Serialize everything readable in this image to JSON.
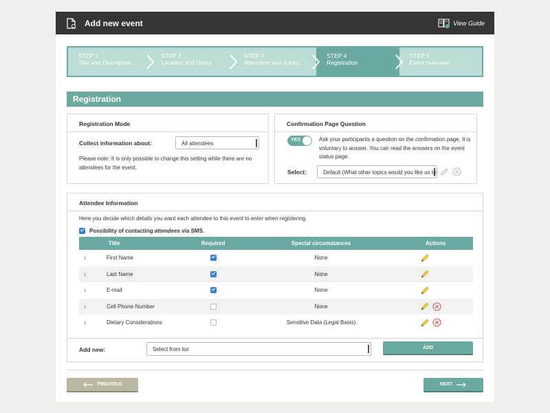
{
  "header": {
    "title": "Add new event",
    "guide_label": "View Guide"
  },
  "steps": [
    {
      "num": "STEP 1",
      "label": "Title and Description"
    },
    {
      "num": "STEP 2",
      "label": "Location and Dates"
    },
    {
      "num": "STEP 3",
      "label": "Attendees and tickets"
    },
    {
      "num": "STEP 4",
      "label": "Registration"
    },
    {
      "num": "STEP 5",
      "label": "Event overview"
    }
  ],
  "active_step": 4,
  "section_title": "Registration",
  "registration_mode": {
    "title": "Registration Mode",
    "collect_label": "Collect information about:",
    "collect_value": "All attendees",
    "note": "Please note: It is only possible to change this setting while there are no attendees for the event."
  },
  "confirmation": {
    "title": "Confirmation Page Question",
    "toggle_label": "YES",
    "toggle_on": true,
    "description": "Ask your participants a question on the confirmation page. It is voluntary to answer. You can read the answers on the event status page.",
    "select_label": "Select:",
    "select_value": "Default (What other topics would you like us to"
  },
  "attendee_info": {
    "title": "Attendee Information",
    "intro": "Here you decide which details you want each attendee to this event to enter when registering.",
    "sms_label": "Possibility of contacting attendees via SMS.",
    "sms_checked": true,
    "columns": {
      "title": "Title",
      "required": "Required",
      "special": "Special circumstances",
      "actions": "Actions"
    },
    "rows": [
      {
        "title": "First Name",
        "required": true,
        "special": "None",
        "deletable": false
      },
      {
        "title": "Last Name",
        "required": true,
        "special": "None",
        "deletable": false
      },
      {
        "title": "E-mail",
        "required": true,
        "special": "None",
        "deletable": false
      },
      {
        "title": "Cell Phone Number",
        "required": false,
        "special": "None",
        "deletable": true
      },
      {
        "title": "Dietary Considerations",
        "required": false,
        "special": "Sensitive Data (Legal Basis)",
        "deletable": true
      }
    ],
    "add_label": "Add new:",
    "add_select": "Select from list",
    "add_button": "ADD"
  },
  "nav": {
    "previous": "PREVIOUS",
    "next": "NEXT"
  },
  "colors": {
    "accent": "#6aaaa0",
    "accent_light": "#bcdcd8",
    "header": "#353535",
    "previous_btn": "#bab8a0",
    "checkbox": "#3a7fd1",
    "delete": "#d9534f",
    "pencil": "#e8b53a"
  }
}
